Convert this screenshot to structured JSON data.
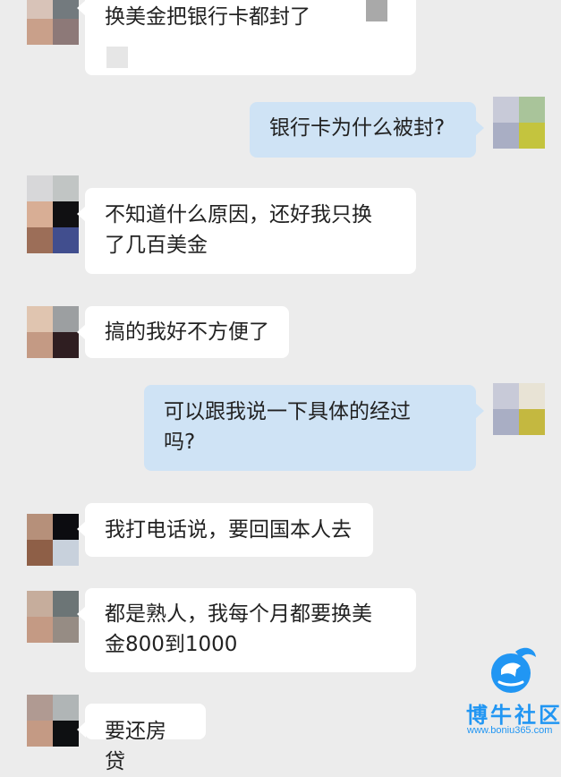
{
  "messages": [
    {
      "side": "in",
      "text": "换美金把银行卡都封了"
    },
    {
      "side": "out",
      "text": "银行卡为什么被封?"
    },
    {
      "side": "in",
      "text": "不知道什么原因，还好我只换\n了几百美金"
    },
    {
      "side": "in",
      "text": "搞的我好不方便了"
    },
    {
      "side": "out",
      "text": "可以跟我说一下具体的经过\n吗?"
    },
    {
      "side": "in",
      "text": "我打电话说，要回国本人去"
    },
    {
      "side": "in",
      "text": "都是熟人，我每个月都要换美\n金800到1000"
    },
    {
      "side": "in",
      "text": "要还房贷"
    }
  ],
  "watermark": {
    "title": "博牛社区",
    "url": "www.boniu365.com",
    "logo_icon": "bull-head-logo-icon",
    "color": "#2196f3"
  },
  "avatars": {
    "a1": [
      "#d8c3b8",
      "#737a7e",
      "#c9a08a",
      "#8d7978"
    ],
    "b1": [
      "#c8cad8",
      "#a9c49a",
      "#a9aec4",
      "#c4c43e"
    ],
    "a2": [
      "#d7d7d9",
      "#c1c5c4",
      "#d8ae95",
      "#101012",
      "#9c6e58",
      "#414e8e"
    ],
    "a3": [
      "#e0c5b0",
      "#9c9fa1",
      "#c49a84",
      "#2f1e21"
    ],
    "b2": [
      "#c8cad8",
      "#e8e3d5",
      "#a9aec4",
      "#c4b840"
    ],
    "a4": [
      "#b6907a",
      "#0c0c10",
      "#8e5f47",
      "#c8d1dc"
    ],
    "a5": [
      "#c6ad9c",
      "#6c7576",
      "#c49a84",
      "#968c84"
    ],
    "a6": [
      "#b09a92",
      "#b0b5b6",
      "#c49a84",
      "#0e1012"
    ]
  }
}
